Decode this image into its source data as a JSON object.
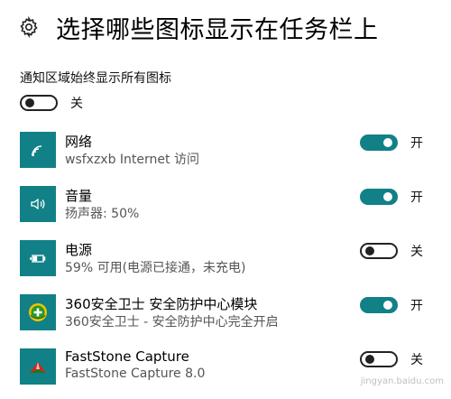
{
  "header": {
    "title": "选择哪些图标显示在任务栏上",
    "icon": "gear-icon"
  },
  "always_show": {
    "label": "通知区域始终显示所有图标",
    "state": "off",
    "state_label": "关"
  },
  "items": [
    {
      "name": "网络",
      "desc": "wsfxzxb Internet 访问",
      "icon": "wifi-icon",
      "state": "on",
      "state_label": "开"
    },
    {
      "name": "音量",
      "desc": "扬声器: 50%",
      "icon": "speaker-icon",
      "state": "on",
      "state_label": "开"
    },
    {
      "name": "电源",
      "desc": "59% 可用(电源已接通，未充电)",
      "icon": "battery-icon",
      "state": "off",
      "state_label": "关"
    },
    {
      "name": "360安全卫士 安全防护中心模块",
      "desc": "360安全卫士 - 安全防护中心完全开启",
      "icon": "360-shield-icon",
      "state": "on",
      "state_label": "开"
    },
    {
      "name": "FastStone Capture",
      "desc": "FastStone Capture 8.0",
      "icon": "faststone-icon",
      "state": "off",
      "state_label": "关"
    }
  ],
  "colors": {
    "accent": "#128087",
    "toggle_off_border": "#222222"
  },
  "watermark": "jingyan.baidu.com"
}
